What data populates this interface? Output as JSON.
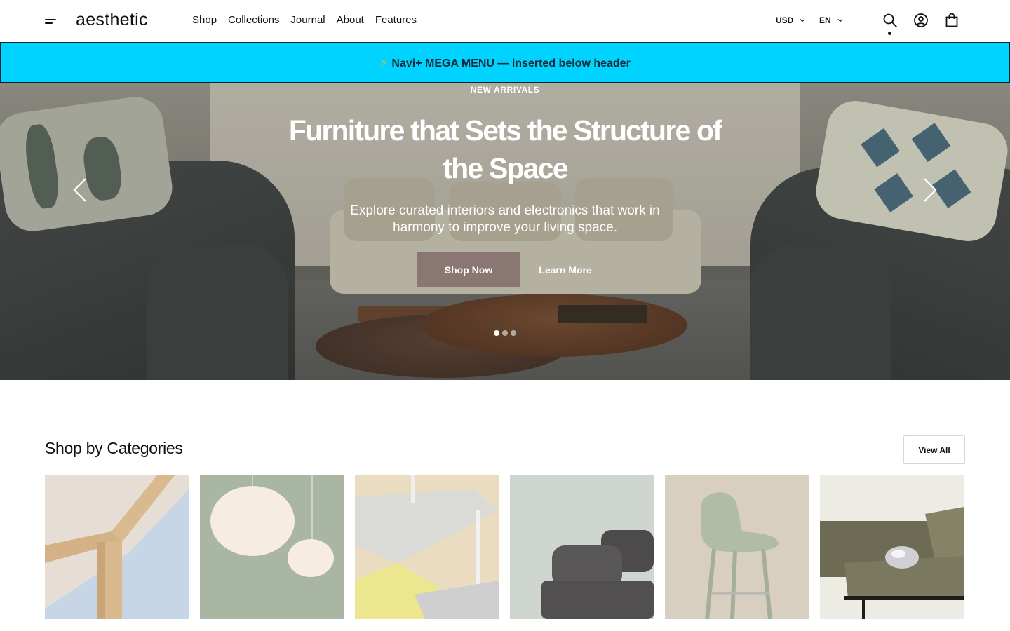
{
  "header": {
    "logo": "aesthetic",
    "nav": [
      "Shop",
      "Collections",
      "Journal",
      "About",
      "Features"
    ],
    "currency": "USD",
    "language": "EN"
  },
  "banner": {
    "icon": "⚡",
    "text": "Navi+ MEGA MENU — inserted below header",
    "bg_color": "#00d3ff"
  },
  "hero": {
    "eyebrow": "NEW ARRIVALS",
    "title": "Furniture that Sets the Structure of the Space",
    "subtitle": "Explore curated interiors and electronics that work in harmony to improve your living space.",
    "primary_cta": "Shop Now",
    "secondary_cta": "Learn More",
    "primary_cta_color": "#8a7673",
    "slide_count": 3,
    "active_slide": 1
  },
  "categories": {
    "title": "Shop by Categories",
    "view_all": "View All",
    "tiles": [
      {
        "icon": "table-corner-image",
        "bg": "#c6d6e6"
      },
      {
        "icon": "pendant-lamps-image",
        "bg": "#a9b6a2"
      },
      {
        "icon": "floor-lamp-image",
        "bg": "#e6d8b8"
      },
      {
        "icon": "sofa-image",
        "bg": "#cfd6cf"
      },
      {
        "icon": "bar-stool-image",
        "bg": "#d9cfc0"
      },
      {
        "icon": "lounge-sofa-image",
        "bg": "#ecebe4"
      }
    ]
  }
}
